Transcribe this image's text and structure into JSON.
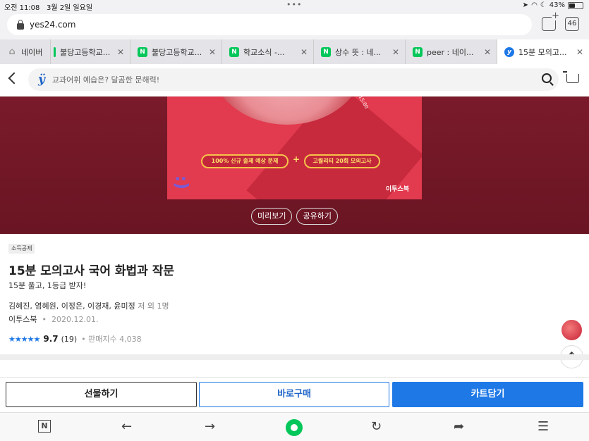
{
  "status": {
    "time": "오전 11:08",
    "date": "3월 2일 일요일",
    "battery": "43%",
    "battery_level": 0.43
  },
  "address_bar": {
    "url": "yes24.com",
    "tab_count": "46"
  },
  "tabs": [
    {
      "label": "네이버",
      "icon": "home-icon",
      "active": false
    },
    {
      "label": "불당고등학교...",
      "icon": "green-bar-icon",
      "active": false
    },
    {
      "label": "불당고등학교...",
      "icon": "naver-icon",
      "active": false
    },
    {
      "label": "학교소식 -...",
      "icon": "naver-icon",
      "active": false
    },
    {
      "label": "상수 뜻 : 네...",
      "icon": "naver-icon",
      "active": false
    },
    {
      "label": "peer : 네이...",
      "icon": "naver-icon",
      "active": false
    },
    {
      "label": "15분 모의고...",
      "icon": "yes24-icon",
      "active": true
    }
  ],
  "site_header": {
    "logo": "ÿ",
    "search_placeholder": "교과어휘 예습은? 달곰한 문해력!"
  },
  "hero": {
    "pill_left": "100% 신규 출제 예상 문제",
    "pill_right": "고퀄리티 20회 모의고사",
    "plus": "+",
    "publisher_logo": "이투스북",
    "clock_time": "15:00",
    "preview_button": "미리보기",
    "share_button": "공유하기"
  },
  "product": {
    "badge": "소득공제",
    "title": "15분 모의고사 국어 화법과 작문",
    "subtitle": "15분 풀고, 1등급 받자!",
    "authors": "김혜진, 염혜원, 이정은, 이경재, 윤미정",
    "authors_suffix": "저 외 1명",
    "publisher": "이투스북",
    "pub_date": "2020.12.01.",
    "rating": "9.7",
    "rating_stars": 5,
    "review_count": "(19)",
    "sales_index": "판매지수 4,038"
  },
  "actions": {
    "gift": "선물하기",
    "buy_now": "바로구매",
    "add_cart": "카트담기"
  },
  "colors": {
    "accent": "#1e78e6",
    "hero_bg": "#7a1a2a",
    "cover": "#e23a4e",
    "naver_green": "#03c75a"
  }
}
